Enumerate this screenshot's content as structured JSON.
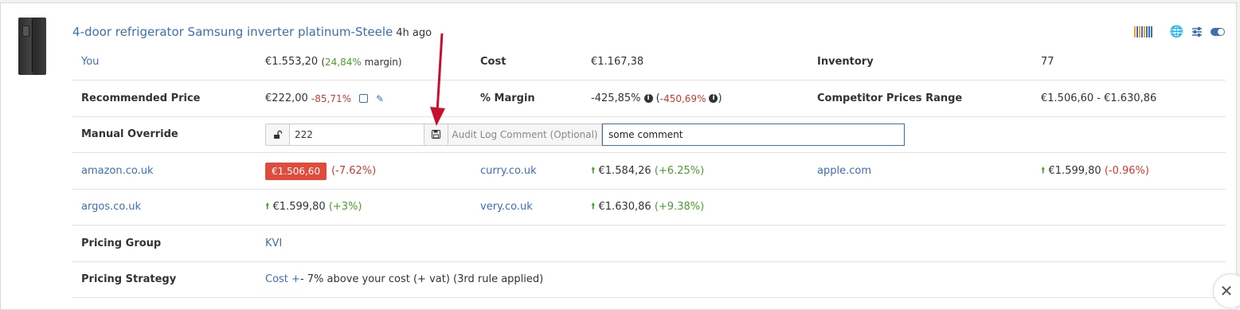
{
  "product": {
    "title": "4-door refrigerator Samsung inverter platinum-Steele",
    "age": "4h ago",
    "image_alt": "refrigerator-thumbnail"
  },
  "header_icons": [
    "barcode-icon",
    "globe-icon",
    "sliders-icon",
    "toggle-icon"
  ],
  "barcode_colors": [
    "#f0a030",
    "#3b6fb6",
    "#f0a030",
    "#3b6fb6",
    "#f0a030",
    "#3b6fb6",
    "#3b6fb6",
    "#3b6fb6"
  ],
  "rows": {
    "you": {
      "label": "You",
      "price": "€1.553,20",
      "margin_open": "(",
      "margin_value": "24,84%",
      "margin_close": " margin)"
    },
    "cost": {
      "label": "Cost",
      "value": "€1.167,38"
    },
    "inventory": {
      "label": "Inventory",
      "value": "77"
    },
    "recommended": {
      "label": "Recommended Price",
      "price": "€222,00",
      "change": "-85,71%"
    },
    "pct_margin": {
      "label": "% Margin",
      "value": "-425,85%",
      "alt_open": "(",
      "alt_value": "-450,69%",
      "alt_close": ")"
    },
    "competitor_range": {
      "label": "Competitor Prices Range",
      "value": "€1.506,60 - €1.630,86"
    },
    "manual_override": {
      "label": "Manual Override",
      "value": "222",
      "comment_label": "Audit Log Comment (Optional)",
      "comment_value": "some comment"
    },
    "competitors": [
      {
        "site": "amazon.co.uk",
        "price": "€1.506,60",
        "change": "(-7.62%)",
        "style": "badge"
      },
      {
        "site": "curry.co.uk",
        "price": "€1.584,26",
        "change": "(+6.25%)",
        "style": "up-green"
      },
      {
        "site": "apple.com",
        "price": "€1.599,80",
        "change": "(-0.96%)",
        "style": "up-red"
      },
      {
        "site": "argos.co.uk",
        "price": "€1.599,80",
        "change": "(+3%)",
        "style": "up-green"
      },
      {
        "site": "very.co.uk",
        "price": "€1.630,86",
        "change": "(+9.38%)",
        "style": "up-green"
      }
    ],
    "pricing_group": {
      "label": "Pricing Group",
      "value": "KVI"
    },
    "pricing_strategy": {
      "label": "Pricing Strategy",
      "link": "Cost +",
      "text": " - 7% above your cost (+ vat) (3rd rule applied)"
    }
  },
  "colors": {
    "link": "#3b6fb6",
    "positive": "#4aa02c",
    "negative": "#d03a2e",
    "badge": "#e04b3c",
    "annotation_arrow": "#c8102e"
  }
}
